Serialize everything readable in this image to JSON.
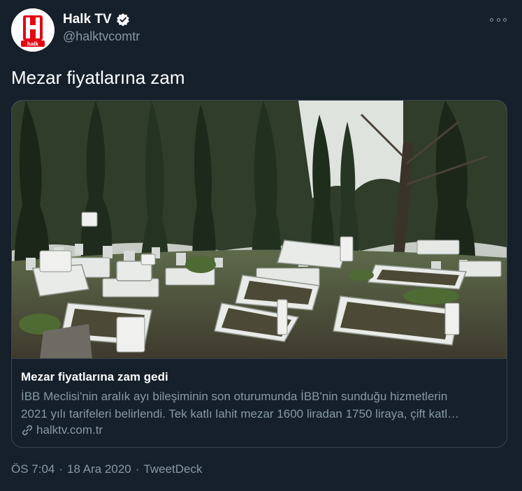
{
  "author": {
    "display_name": "Halk TV",
    "handle": "@halktvcomtr",
    "avatar_text": "halk",
    "verified": true
  },
  "tweet": {
    "text": "Mezar fiyatlarına zam"
  },
  "card": {
    "title": "Mezar fiyatlarına zam gedi",
    "description_line1": "İBB Meclisi'nin aralık ayı bileşiminin son oturumunda İBB'nin sunduğu hizmetlerin",
    "description_line2": "2021 yılı tarifeleri belirlendi. Tek katlı lahit mezar 1600 liradan 1750 liraya, çift katl…",
    "domain": "halktv.com.tr",
    "image_icon": "cemetery-photo"
  },
  "meta": {
    "time": "ÖS 7:04",
    "separator1": "·",
    "date": "18 Ara 2020",
    "separator2": "·",
    "source": "TweetDeck"
  },
  "colors": {
    "background": "#15202b",
    "secondary_text": "#8899a6",
    "border": "#38444d",
    "brand_red": "#e30613"
  }
}
